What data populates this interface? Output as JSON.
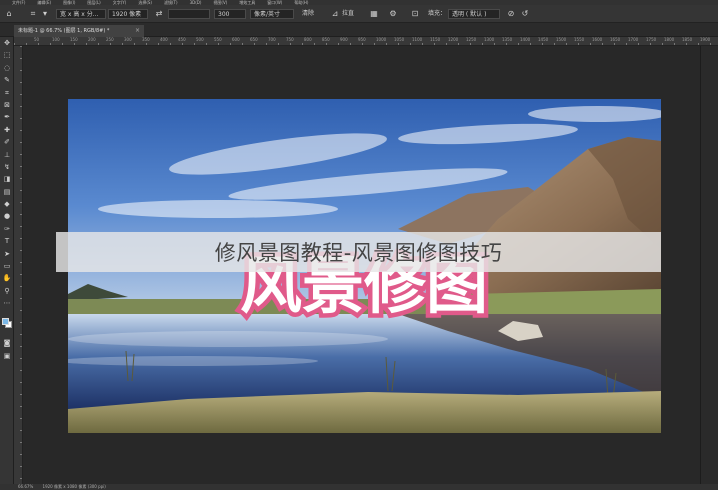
{
  "menubar": {
    "items": [
      "文件(F)",
      "编辑(E)",
      "图像(I)",
      "图层(L)",
      "文字(Y)",
      "选择(S)",
      "滤镜(T)",
      "3D(D)",
      "视图(V)",
      "增效工具",
      "窗口(W)",
      "帮助(H)"
    ]
  },
  "options_bar": {
    "ratio_select": "宽 x 高 x 分...",
    "width_value": "1920 像素",
    "swap_icon": "⇄",
    "height_value": "",
    "resolution_value": "300",
    "resolution_unit": "像素/英寸",
    "clear_label": "清除",
    "straighten_label": "拉直",
    "fill_label": "填充：",
    "fill_value": "透明 ( 默认 )"
  },
  "document": {
    "tab_title": "未标题-1 @ 66.7% (图层 1, RGB/8#) *",
    "close": "×"
  },
  "ruler": {
    "ticks": [
      "50",
      "100",
      "150",
      "200",
      "250",
      "300",
      "350",
      "400",
      "450",
      "500",
      "550",
      "600",
      "650",
      "700",
      "750",
      "800",
      "850",
      "900",
      "950",
      "1000",
      "1050",
      "1100",
      "1150",
      "1200",
      "1250",
      "1300",
      "1350",
      "1400",
      "1450",
      "1500",
      "1550",
      "1600",
      "1650",
      "1700",
      "1750",
      "1800",
      "1850",
      "1900"
    ]
  },
  "image": {
    "title_text": "风景修图",
    "title_color": "#e05a8a"
  },
  "banner": {
    "text": "修风景图教程-风景图修图技巧"
  },
  "status": {
    "zoom": "66.67%",
    "info": "1920 像素 x 1080 像素 (300 ppi)"
  },
  "colors": {
    "foreground": "#7ab7e6",
    "background": "#ffffff"
  }
}
